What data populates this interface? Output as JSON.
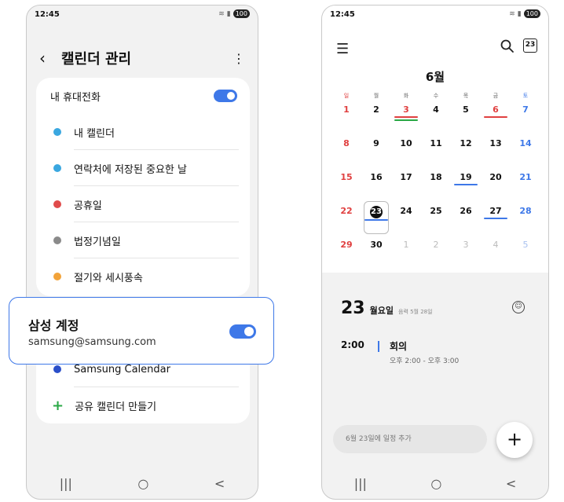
{
  "left_phone": {
    "status": {
      "time": "12:45",
      "battery": "100"
    },
    "header": {
      "back": "‹",
      "title": "캘린더 관리",
      "more": "⋮"
    },
    "device_section": {
      "label": "내 휴대전화",
      "items": [
        {
          "label": "내 캘린더",
          "color": "#3aa7e0"
        },
        {
          "label": "연락처에 저장된 중요한 날",
          "color": "#3aa7e0"
        },
        {
          "label": "공휴일",
          "color": "#e04b4b"
        },
        {
          "label": "법정기념일",
          "color": "#8a8a8a"
        },
        {
          "label": "절기와 세시풍속",
          "color": "#f2a33a"
        }
      ]
    },
    "account_popup": {
      "title": "삼성 계정",
      "email": "samsung@samsung.com"
    },
    "account_section": {
      "calendar_label": "Samsung Calendar",
      "calendar_color": "#2a4fc9",
      "add_shared_label": "공유 캘린더 만들기"
    },
    "nav": {
      "recents": "|||",
      "home": "○",
      "back": "<"
    }
  },
  "right_phone": {
    "status": {
      "time": "12:45",
      "battery": "100"
    },
    "today_badge": "23",
    "month": "6월",
    "weekdays": [
      "일",
      "월",
      "화",
      "수",
      "목",
      "금",
      "토"
    ],
    "weeks": [
      [
        "1",
        "2",
        "3",
        "4",
        "5",
        "6",
        "7"
      ],
      [
        "8",
        "9",
        "10",
        "11",
        "12",
        "13",
        "14"
      ],
      [
        "15",
        "16",
        "17",
        "18",
        "19",
        "20",
        "21"
      ],
      [
        "22",
        "23",
        "24",
        "25",
        "26",
        "27",
        "28"
      ],
      [
        "29",
        "30",
        "1",
        "2",
        "3",
        "4",
        "5"
      ]
    ],
    "selected_day": {
      "number": "23",
      "weekday": "월요일",
      "lunar": "음력 5월 28일"
    },
    "event": {
      "time": "2:00",
      "title": "회의",
      "detail": "오후 2:00 - 오후 3:00"
    },
    "add_placeholder": "6월 23일에 일정 추가",
    "fab": "+",
    "nav": {
      "recents": "|||",
      "home": "○",
      "back": "<"
    }
  }
}
